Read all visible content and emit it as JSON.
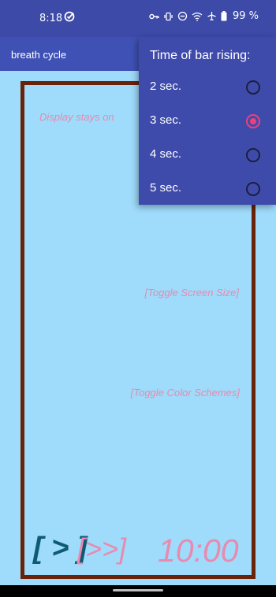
{
  "status_bar": {
    "time": "8:18",
    "battery": "99 %",
    "icons": [
      "check-circle-icon",
      "key-icon",
      "vibrate-icon",
      "do-not-disturb-icon",
      "wifi-icon",
      "airplane-icon",
      "battery-icon"
    ]
  },
  "app_bar": {
    "title": "breath cycle"
  },
  "content": {
    "hint_display": "Display stays on",
    "hint_screen_size": "[Toggle Screen Size]",
    "hint_color_schemes": "[Toggle Color Schemes]",
    "play_label": "[ > ]",
    "fast_forward_label": "[>>]",
    "timer": "10:00"
  },
  "popup": {
    "title": "Time of bar rising:",
    "options": [
      {
        "label": "2 sec.",
        "checked": false
      },
      {
        "label": "3 sec.",
        "checked": true
      },
      {
        "label": "4 sec.",
        "checked": false
      },
      {
        "label": "5 sec.",
        "checked": false
      }
    ]
  },
  "colors": {
    "app_bar": "#3f51b5",
    "background": "#9fdbfb",
    "frame": "#6a2208",
    "accent_pink": "#e98aaf",
    "play_teal": "#0e5b74",
    "radio_selected": "#ec407a"
  }
}
